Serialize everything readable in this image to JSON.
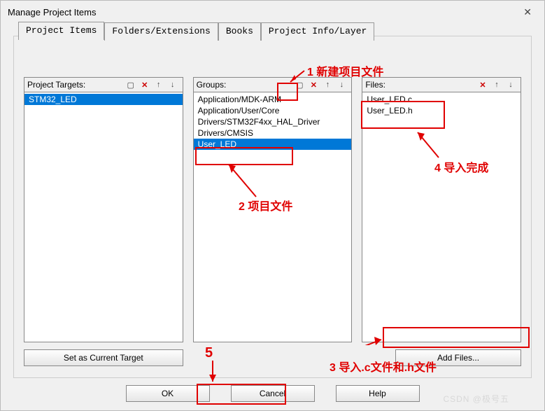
{
  "window": {
    "title": "Manage Project Items",
    "closeGlyph": "✕"
  },
  "tabs": [
    "Project Items",
    "Folders/Extensions",
    "Books",
    "Project Info/Layer"
  ],
  "columns": {
    "targets": {
      "label": "Project Targets:",
      "items": [
        {
          "text": "STM32_LED",
          "selected": true
        }
      ]
    },
    "groups": {
      "label": "Groups:",
      "items": [
        {
          "text": "Application/MDK-ARM"
        },
        {
          "text": "Application/User/Core"
        },
        {
          "text": "Drivers/STM32F4xx_HAL_Driver"
        },
        {
          "text": "Drivers/CMSIS"
        },
        {
          "text": "User_LED",
          "selected": true
        }
      ]
    },
    "files": {
      "label": "Files:",
      "items": [
        {
          "text": "User_LED.c"
        },
        {
          "text": "User_LED.h"
        }
      ]
    }
  },
  "buttons": {
    "setTarget": "Set as Current Target",
    "addFiles": "Add Files...",
    "ok": "OK",
    "cancel": "Cancel",
    "help": "Help"
  },
  "annotations": {
    "a1": "1 新建项目文件",
    "a2": "2 项目文件",
    "a3": "3 导入.c文件和.h文件",
    "a4": "4 导入完成",
    "a5": "5"
  },
  "icons": {
    "new": "▢",
    "del": "✕",
    "up": "↑",
    "down": "↓"
  },
  "watermark": "CSDN @极号五"
}
